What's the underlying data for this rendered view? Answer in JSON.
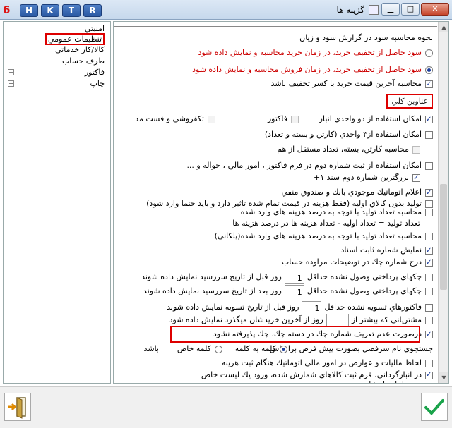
{
  "titlebar": {
    "app_logo": "6",
    "buttons": [
      "H",
      "K",
      "T",
      "R"
    ],
    "title": "گزينه ها",
    "min_label": "▁",
    "max_label": "□",
    "close_label": "✕"
  },
  "tree": {
    "items": [
      {
        "label": "امنيتي",
        "expandable": false
      },
      {
        "label": "تنظيمات عمومي",
        "expandable": false,
        "selected": true
      },
      {
        "label": "كالا/كار خدماتي",
        "expandable": false
      },
      {
        "label": "طرف حساب",
        "expandable": false
      },
      {
        "label": "فاكتور",
        "expandable": true
      },
      {
        "label": "چاپ",
        "expandable": true
      }
    ]
  },
  "profit": {
    "heading": "نحوه محاسبه سود در گزارش سود و زيان",
    "option1": "سود حاصل از تخفيف خريد، در زمان خريد محاسبه و نمايش داده شود",
    "option2": "سود حاصل از تخفيف خريد، در زمان فروش محاسبه و نمايش داده شود",
    "last_price": "محاسبه آخرين قيمت خريد با كسر تخفيف باشد"
  },
  "general": {
    "section_title": "عناوين كلي",
    "two_units": "امكان استفاده از دو واحدي انبار",
    "invoice": "فاكتور",
    "retail": "تكفروشي و فست مد",
    "three_units": "امكان استفاده از۳ واحدي (كارتن و بسته و تعداد)",
    "carton_calc": "محاسبه كارتن، بسته، تعداد مستقل از هم",
    "second_number": "امكان استفاده از ثبت شماره دوم در فرم فاكتور ، امور مالي ، حواله و ...",
    "bigger_second": "بزرگترين شماره دوم سند ۱+",
    "auto_balance": "اعلام اتوماتيك موجودي بانك و صندوق منفي",
    "produce_no_initial": "توليد بدون كالاي اوليه (فقط هزينه در قيمت تمام شده تاثير دارد و بايد حتما وارد شود)",
    "calc_produce_qty": "محاسبه تعداد توليد با توجه به درصد هزينه هاي وارد شده",
    "produce_formula": "تعداد توليد = تعداد اوليه - تعداد هزينه ها در درصد هزينه ها",
    "calc_produce_qty2": "محاسبه تعداد توليد با توجه به درصد هزينه هاي وارد شده(پلكاني)",
    "fixed_number": "نمايش شماره ثابت اسناد",
    "check_in_desc": "درج شماره چك در توضيحات مراوده حساب",
    "checks_before": "چكهاي پرداختي وصول نشده حداقل",
    "checks_before_value": "1",
    "checks_before_suffix": "روز قبل از تاريخ سررسيد نمايش داده شوند",
    "checks_after": "چكهاي پرداختي وصول نشده حداقل",
    "checks_after_value": "1",
    "checks_after_suffix": "روز بعد از تاريخ سررسيد نمايش داده شوند",
    "invoices_unsettled": "فاكتورهاي تسويه نشده حداقل",
    "invoices_unsettled_value": "1",
    "invoices_unsettled_suffix": "روز قبل از تاريخ تسويه نمايش داده شوند",
    "customers_more": "مشترياني كه بيشتر از",
    "customers_more_value": "",
    "customers_more_suffix": "روز از آخرين خريدشان ميگذرد نمايش داده شود",
    "undefined_check": "درصورت عدم تعريف شماره چك در دسته چك، چك پذيرفته نشود",
    "search_default": "جستجوي نام سرفصل بصورت پيش فرض براساس",
    "search_word_part": "كلمه به كلمه",
    "search_whole_word": "كلمه خاص",
    "search_suffix": "باشد",
    "auto_tax": "لحاظ ماليات و عوارض در امور مالي اتوماتيك هنگام ثبت هزينه",
    "warehouse_serial": "در انبارگرداني، فرم ثبت كالاهاي شمارش شده، ورود يك ليست خاص موجودي انبار را نشان دهد ."
  }
}
